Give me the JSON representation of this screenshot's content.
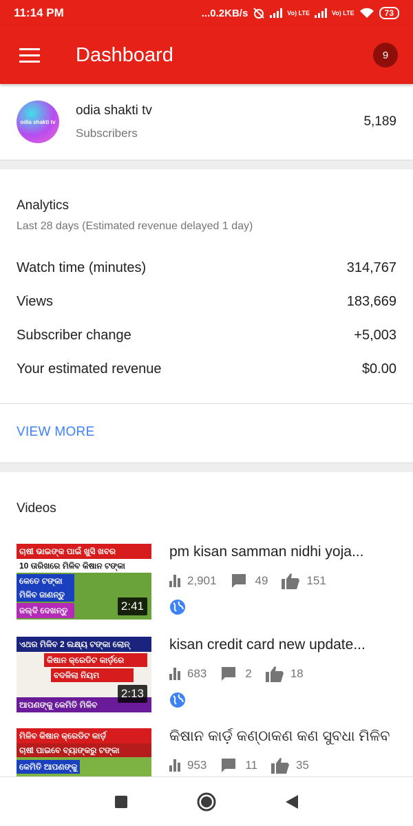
{
  "status_bar": {
    "time": "11:14 PM",
    "net_speed": "...0.2KB/s",
    "lte1": "Vo) LTE",
    "lte2": "Vo) LTE",
    "battery": "73",
    "icons": [
      "alarm-off-icon",
      "signal-icon",
      "wifi-icon",
      "battery-icon"
    ]
  },
  "app_bar": {
    "title": "Dashboard",
    "notification_count": "9",
    "color": "#e62117"
  },
  "channel": {
    "name": "odia shakti tv",
    "avatar_text": "odia shakti tv",
    "subscribers_label": "Subscribers",
    "subscriber_count": "5,189"
  },
  "analytics": {
    "title": "Analytics",
    "subtitle": "Last 28 days (Estimated revenue delayed 1 day)",
    "metrics": [
      {
        "label": "Watch time (minutes)",
        "value": "314,767"
      },
      {
        "label": "Views",
        "value": "183,669"
      },
      {
        "label": "Subscriber change",
        "value": "+5,003"
      },
      {
        "label": "Your estimated revenue",
        "value": "$0.00"
      }
    ],
    "view_more": "VIEW MORE",
    "link_color": "#3e82f7"
  },
  "videos": {
    "title": "Videos",
    "items": [
      {
        "title": "pm kisan samman nidhi yoja...",
        "views": "2,901",
        "comments": "49",
        "likes": "151",
        "duration": "2:41",
        "thumb_lines": [
          "ଚାଷୀ ଭାଇଙ୍କ ପାଇଁ ଖୁସି ଖବର",
          "10 ତାରିଖରେ ମିଳିବ କିଷାନ ଟଙ୍କା",
          "କେତେ ଟଙ୍କା",
          "ମିଳିବ ଜାଣନ୍ତୁ",
          "ଜଲ୍ଦି ଦେଖନ୍ତୁ"
        ]
      },
      {
        "title": "kisan credit card new update...",
        "views": "683",
        "comments": "2",
        "likes": "18",
        "duration": "2:13",
        "thumb_lines": [
          "ଏଥର ମିଳିବ 2 ଲକ୍ଷ୍ୟ ଟଙ୍କା ଲୋନ୍",
          "କିଷାନ କ୍ରେଡିଟ କାର୍ଡ଼ରେ",
          "ବଦଳିଲା ନିୟମ",
          "ଆପଣଙ୍କୁ କେମିତି ମିଳିବ"
        ]
      },
      {
        "title": "କିଷାନ କାର୍ଡ଼ କଣ୍ଠାକଣ କଣ ସୁବଧା ମିଳିବ",
        "views": "953",
        "comments": "11",
        "likes": "35",
        "thumb_lines": [
          "ମିଳିବ କିଷାନ କ୍ରେଡିଟ କାର୍ଡ଼",
          "ଚାଷୀ ପାଇବେ ବ୍ୟାଙ୍କରୁ ଟଙ୍କା",
          "କେମିତି ଆପଣଙ୍କୁ"
        ]
      }
    ]
  },
  "nav_bar": {
    "icons": [
      "recents-square-icon",
      "home-circle-icon",
      "back-triangle-icon"
    ]
  }
}
